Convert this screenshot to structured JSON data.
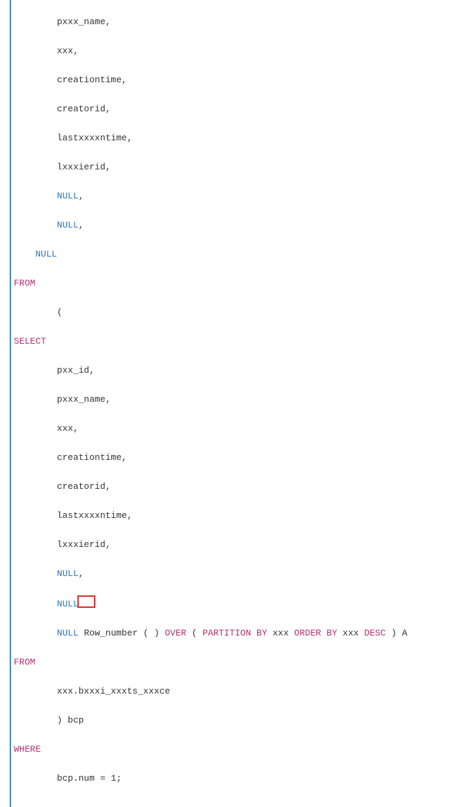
{
  "code": {
    "ind1": "        ",
    "ind2": "    ",
    "ind0": "",
    "cols1": {
      "c0": "pxxx_name",
      "c1": "xxx",
      "c2": "creationtime",
      "c3": "creatorid",
      "c4": "lastxxxxntime",
      "c5": "lxxxierid"
    },
    "null": "NULL",
    "from": "FROM",
    "select": "SELECT",
    "paren_open": "(",
    "cols2": {
      "c0": "pxx_id",
      "c1": "pxxx_name",
      "c2": "xxx",
      "c3": "creationtime",
      "c4": "creatorid",
      "c5": "lastxxxxntime",
      "c6": "lxxxierid"
    },
    "rownum_line": {
      "row_number": "Row_number",
      "over": "OVER",
      "partition_by": "PARTITION BY",
      "xxx1": "xxx",
      "order_by": "ORDER BY",
      "xxx2": "xxx",
      "desc": "DESC",
      "a": "A"
    },
    "table": "xxx.bxxxi_xxxts_xxxce",
    "alias_close": ") bcp",
    "where": "WHERE",
    "predicate": {
      "lhs": "bcp.num",
      "eq": "=",
      "rhs": "1",
      "semi": ";"
    },
    "comma": ","
  }
}
